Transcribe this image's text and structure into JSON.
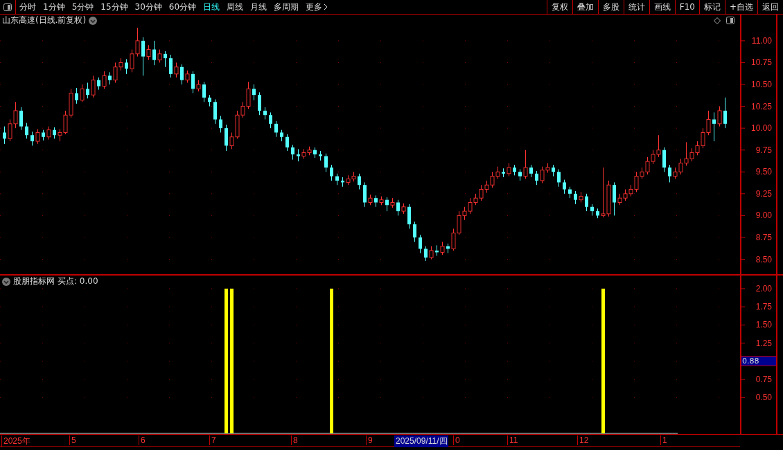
{
  "toolbar": {
    "periods": [
      {
        "label": "分时",
        "selected": false
      },
      {
        "label": "1分钟",
        "selected": false
      },
      {
        "label": "5分钟",
        "selected": false
      },
      {
        "label": "15分钟",
        "selected": false
      },
      {
        "label": "30分钟",
        "selected": false
      },
      {
        "label": "60分钟",
        "selected": false
      },
      {
        "label": "日线",
        "selected": true
      },
      {
        "label": "周线",
        "selected": false
      },
      {
        "label": "月线",
        "selected": false
      },
      {
        "label": "多周期",
        "selected": false
      },
      {
        "label": "更多",
        "selected": false
      }
    ],
    "actions": [
      "复权",
      "叠加",
      "多股",
      "统计",
      "画线",
      "F10",
      "标记",
      "+自选",
      "返回"
    ]
  },
  "price_panel": {
    "title": "山东高速(日线.前复权)",
    "chart_data": {
      "type": "candlestick",
      "ylim": [
        8.33,
        11.3
      ],
      "grid": true,
      "yticks": [
        {
          "value": 11,
          "label": "11.00"
        },
        {
          "value": 10.75,
          "label": "10.75"
        },
        {
          "value": 10.5,
          "label": "10.50"
        },
        {
          "value": 10.25,
          "label": "10.25"
        },
        {
          "value": 10,
          "label": "10.00"
        },
        {
          "value": 9.75,
          "label": "9.75"
        },
        {
          "value": 9.5,
          "label": "9.50"
        },
        {
          "value": 9.25,
          "label": "9.25"
        },
        {
          "value": 9,
          "label": "9.00"
        },
        {
          "value": 8.75,
          "label": "8.75"
        },
        {
          "value": 8.5,
          "label": "8.50"
        }
      ],
      "ohlc": [
        [
          9.95,
          10.02,
          9.82,
          9.88
        ],
        [
          9.88,
          10.1,
          9.85,
          10.05
        ],
        [
          10.05,
          10.3,
          10.0,
          10.2
        ],
        [
          10.2,
          10.24,
          9.98,
          10.02
        ],
        [
          10.02,
          10.06,
          9.88,
          9.92
        ],
        [
          9.92,
          9.96,
          9.8,
          9.85
        ],
        [
          9.85,
          9.99,
          9.82,
          9.95
        ],
        [
          9.95,
          9.98,
          9.86,
          9.9
        ],
        [
          9.9,
          10.02,
          9.87,
          9.98
        ],
        [
          9.98,
          10.01,
          9.88,
          9.92
        ],
        [
          9.92,
          9.99,
          9.85,
          9.95
        ],
        [
          9.95,
          10.2,
          9.93,
          10.15
        ],
        [
          10.15,
          10.45,
          10.12,
          10.4
        ],
        [
          10.4,
          10.46,
          10.28,
          10.32
        ],
        [
          10.32,
          10.5,
          10.3,
          10.45
        ],
        [
          10.45,
          10.52,
          10.34,
          10.38
        ],
        [
          10.38,
          10.6,
          10.35,
          10.55
        ],
        [
          10.55,
          10.58,
          10.44,
          10.48
        ],
        [
          10.48,
          10.65,
          10.45,
          10.6
        ],
        [
          10.6,
          10.64,
          10.5,
          10.55
        ],
        [
          10.55,
          10.75,
          10.52,
          10.7
        ],
        [
          10.7,
          10.8,
          10.66,
          10.75
        ],
        [
          10.75,
          10.79,
          10.62,
          10.68
        ],
        [
          10.68,
          10.9,
          10.64,
          10.85
        ],
        [
          10.85,
          11.15,
          10.82,
          11.0
        ],
        [
          11.0,
          11.04,
          10.6,
          10.82
        ],
        [
          10.82,
          10.95,
          10.78,
          10.9
        ],
        [
          10.9,
          11.0,
          10.72,
          10.78
        ],
        [
          10.78,
          10.9,
          10.75,
          10.85
        ],
        [
          10.85,
          10.88,
          10.7,
          10.8
        ],
        [
          10.8,
          10.84,
          10.58,
          10.62
        ],
        [
          10.62,
          10.75,
          10.58,
          10.7
        ],
        [
          10.7,
          10.73,
          10.5,
          10.55
        ],
        [
          10.55,
          10.66,
          10.52,
          10.62
        ],
        [
          10.62,
          10.65,
          10.4,
          10.45
        ],
        [
          10.45,
          10.55,
          10.42,
          10.5
        ],
        [
          10.5,
          10.53,
          10.3,
          10.35
        ],
        [
          10.35,
          10.38,
          10.25,
          10.3
        ],
        [
          10.3,
          10.33,
          10.05,
          10.1
        ],
        [
          10.1,
          10.14,
          9.95,
          10.0
        ],
        [
          10.0,
          10.04,
          9.74,
          9.8
        ],
        [
          9.8,
          9.95,
          9.76,
          9.9
        ],
        [
          9.9,
          10.2,
          9.88,
          10.15
        ],
        [
          10.15,
          10.3,
          10.12,
          10.25
        ],
        [
          10.25,
          10.53,
          10.22,
          10.45
        ],
        [
          10.45,
          10.5,
          10.32,
          10.38
        ],
        [
          10.38,
          10.41,
          10.15,
          10.2
        ],
        [
          10.2,
          10.24,
          10.1,
          10.15
        ],
        [
          10.15,
          10.18,
          10.0,
          10.05
        ],
        [
          10.05,
          10.08,
          9.9,
          9.95
        ],
        [
          9.95,
          9.98,
          9.85,
          9.9
        ],
        [
          9.9,
          9.93,
          9.74,
          9.78
        ],
        [
          9.78,
          9.81,
          9.64,
          9.7
        ],
        [
          9.7,
          9.76,
          9.62,
          9.68
        ],
        [
          9.68,
          9.76,
          9.65,
          9.72
        ],
        [
          9.72,
          9.79,
          9.69,
          9.75
        ],
        [
          9.75,
          9.78,
          9.66,
          9.7
        ],
        [
          9.7,
          9.74,
          9.63,
          9.68
        ],
        [
          9.68,
          9.71,
          9.5,
          9.55
        ],
        [
          9.55,
          9.58,
          9.4,
          9.45
        ],
        [
          9.45,
          9.48,
          9.35,
          9.4
        ],
        [
          9.4,
          9.44,
          9.33,
          9.38
        ],
        [
          9.38,
          9.46,
          9.35,
          9.42
        ],
        [
          9.42,
          9.5,
          9.39,
          9.45
        ],
        [
          9.45,
          9.48,
          9.3,
          9.35
        ],
        [
          9.35,
          9.38,
          9.1,
          9.15
        ],
        [
          9.15,
          9.24,
          9.12,
          9.2
        ],
        [
          9.2,
          9.23,
          9.1,
          9.15
        ],
        [
          9.15,
          9.22,
          9.12,
          9.18
        ],
        [
          9.18,
          9.21,
          9.05,
          9.12
        ],
        [
          9.12,
          9.2,
          9.09,
          9.15
        ],
        [
          9.15,
          9.18,
          9.0,
          9.05
        ],
        [
          9.05,
          9.14,
          9.02,
          9.1
        ],
        [
          9.1,
          9.13,
          8.85,
          8.9
        ],
        [
          8.9,
          8.93,
          8.7,
          8.75
        ],
        [
          8.75,
          8.78,
          8.57,
          8.62
        ],
        [
          8.62,
          8.65,
          8.48,
          8.52
        ],
        [
          8.52,
          8.65,
          8.5,
          8.6
        ],
        [
          8.6,
          8.66,
          8.54,
          8.58
        ],
        [
          8.58,
          8.7,
          8.55,
          8.65
        ],
        [
          8.65,
          8.68,
          8.57,
          8.62
        ],
        [
          8.62,
          8.85,
          8.6,
          8.8
        ],
        [
          8.8,
          9.05,
          8.78,
          9.0
        ],
        [
          9.0,
          9.1,
          8.95,
          9.05
        ],
        [
          9.05,
          9.2,
          9.02,
          9.15
        ],
        [
          9.15,
          9.25,
          9.12,
          9.2
        ],
        [
          9.2,
          9.35,
          9.17,
          9.3
        ],
        [
          9.3,
          9.4,
          9.26,
          9.35
        ],
        [
          9.35,
          9.5,
          9.32,
          9.45
        ],
        [
          9.45,
          9.56,
          9.42,
          9.5
        ],
        [
          9.5,
          9.54,
          9.44,
          9.48
        ],
        [
          9.48,
          9.6,
          9.45,
          9.55
        ],
        [
          9.55,
          9.58,
          9.46,
          9.5
        ],
        [
          9.5,
          9.53,
          9.4,
          9.45
        ],
        [
          9.45,
          9.75,
          9.42,
          9.55
        ],
        [
          9.55,
          9.58,
          9.44,
          9.48
        ],
        [
          9.48,
          9.51,
          9.35,
          9.4
        ],
        [
          9.4,
          9.56,
          9.37,
          9.52
        ],
        [
          9.52,
          9.6,
          9.49,
          9.55
        ],
        [
          9.55,
          9.58,
          9.45,
          9.5
        ],
        [
          9.5,
          9.53,
          9.33,
          9.38
        ],
        [
          9.38,
          9.41,
          9.25,
          9.3
        ],
        [
          9.3,
          9.33,
          9.2,
          9.25
        ],
        [
          9.25,
          9.28,
          9.13,
          9.18
        ],
        [
          9.18,
          9.27,
          9.15,
          9.22
        ],
        [
          9.22,
          9.25,
          9.05,
          9.1
        ],
        [
          9.1,
          9.13,
          9.0,
          9.05
        ],
        [
          9.05,
          9.08,
          8.97,
          9.0
        ],
        [
          9.0,
          9.55,
          8.98,
          9.02
        ],
        [
          9.02,
          9.4,
          8.99,
          9.35
        ],
        [
          9.35,
          9.38,
          9.0,
          9.15
        ],
        [
          9.15,
          9.25,
          9.12,
          9.2
        ],
        [
          9.2,
          9.3,
          9.17,
          9.25
        ],
        [
          9.25,
          9.35,
          9.22,
          9.3
        ],
        [
          9.3,
          9.5,
          9.27,
          9.45
        ],
        [
          9.45,
          9.55,
          9.42,
          9.5
        ],
        [
          9.5,
          9.67,
          9.47,
          9.62
        ],
        [
          9.62,
          9.75,
          9.59,
          9.7
        ],
        [
          9.7,
          9.92,
          9.67,
          9.75
        ],
        [
          9.75,
          9.78,
          9.5,
          9.55
        ],
        [
          9.55,
          9.58,
          9.38,
          9.45
        ],
        [
          9.45,
          9.55,
          9.42,
          9.5
        ],
        [
          9.5,
          9.65,
          9.47,
          9.6
        ],
        [
          9.6,
          9.84,
          9.57,
          9.65
        ],
        [
          9.65,
          9.77,
          9.62,
          9.72
        ],
        [
          9.72,
          9.85,
          9.69,
          9.8
        ],
        [
          9.8,
          10.0,
          9.77,
          9.95
        ],
        [
          9.95,
          10.2,
          9.92,
          10.1
        ],
        [
          10.1,
          10.18,
          9.85,
          10.05
        ],
        [
          10.05,
          10.25,
          10.02,
          10.2
        ],
        [
          10.2,
          10.35,
          10.0,
          10.05
        ]
      ]
    }
  },
  "indicator_panel": {
    "title": "股朋指标网",
    "reading": "买点: 0.00",
    "cursor_value": "0.88",
    "chart_data": {
      "type": "bar",
      "ylim": [
        0,
        2.18
      ],
      "grid": true,
      "yticks": [
        {
          "value": 2,
          "label": "2.00"
        },
        {
          "value": 1.75,
          "label": "1.75"
        },
        {
          "value": 1.5,
          "label": "1.50"
        },
        {
          "value": 1.25,
          "label": "1.25"
        },
        {
          "value": 0.75,
          "label": "0.75"
        },
        {
          "value": 0.5,
          "label": "0.50"
        }
      ],
      "values": [
        0,
        0,
        0,
        0,
        0,
        0,
        0,
        0,
        0,
        0,
        0,
        0,
        0,
        0,
        0,
        0,
        0,
        0,
        0,
        0,
        0,
        0,
        0,
        0,
        0,
        0,
        0,
        0,
        0,
        0,
        0,
        0,
        0,
        0,
        0,
        0,
        0,
        0,
        0,
        0,
        2,
        2,
        0,
        0,
        0,
        0,
        0,
        0,
        0,
        0,
        0,
        0,
        0,
        0,
        0,
        0,
        0,
        0,
        0,
        2,
        0,
        0,
        0,
        0,
        0,
        0,
        0,
        0,
        0,
        0,
        0,
        0,
        0,
        0,
        0,
        0,
        0,
        0,
        0,
        0,
        0,
        0,
        0,
        0,
        0,
        0,
        0,
        0,
        0,
        0,
        0,
        0,
        0,
        0,
        0,
        0,
        0,
        0,
        0,
        0,
        0,
        0,
        0,
        0,
        0,
        0,
        0,
        0,
        2,
        0,
        0,
        0,
        0,
        0,
        0,
        0,
        0,
        0,
        0,
        0,
        0,
        0,
        0,
        0,
        0,
        0,
        0,
        0,
        0,
        0,
        0
      ]
    }
  },
  "date_axis": {
    "labels": [
      {
        "kind": "tick",
        "text": "2025年"
      },
      {
        "kind": "tick",
        "text": "5"
      },
      {
        "kind": "tick",
        "text": "6"
      },
      {
        "kind": "tick",
        "text": "7"
      },
      {
        "kind": "tick",
        "text": "8"
      },
      {
        "kind": "tick",
        "text": "9"
      },
      {
        "kind": "cursor",
        "text": "2025/09/11/四"
      },
      {
        "kind": "tick",
        "text": "0"
      },
      {
        "kind": "tick",
        "text": "11"
      },
      {
        "kind": "tick",
        "text": "12"
      },
      {
        "kind": "tick",
        "text": "1"
      }
    ]
  }
}
